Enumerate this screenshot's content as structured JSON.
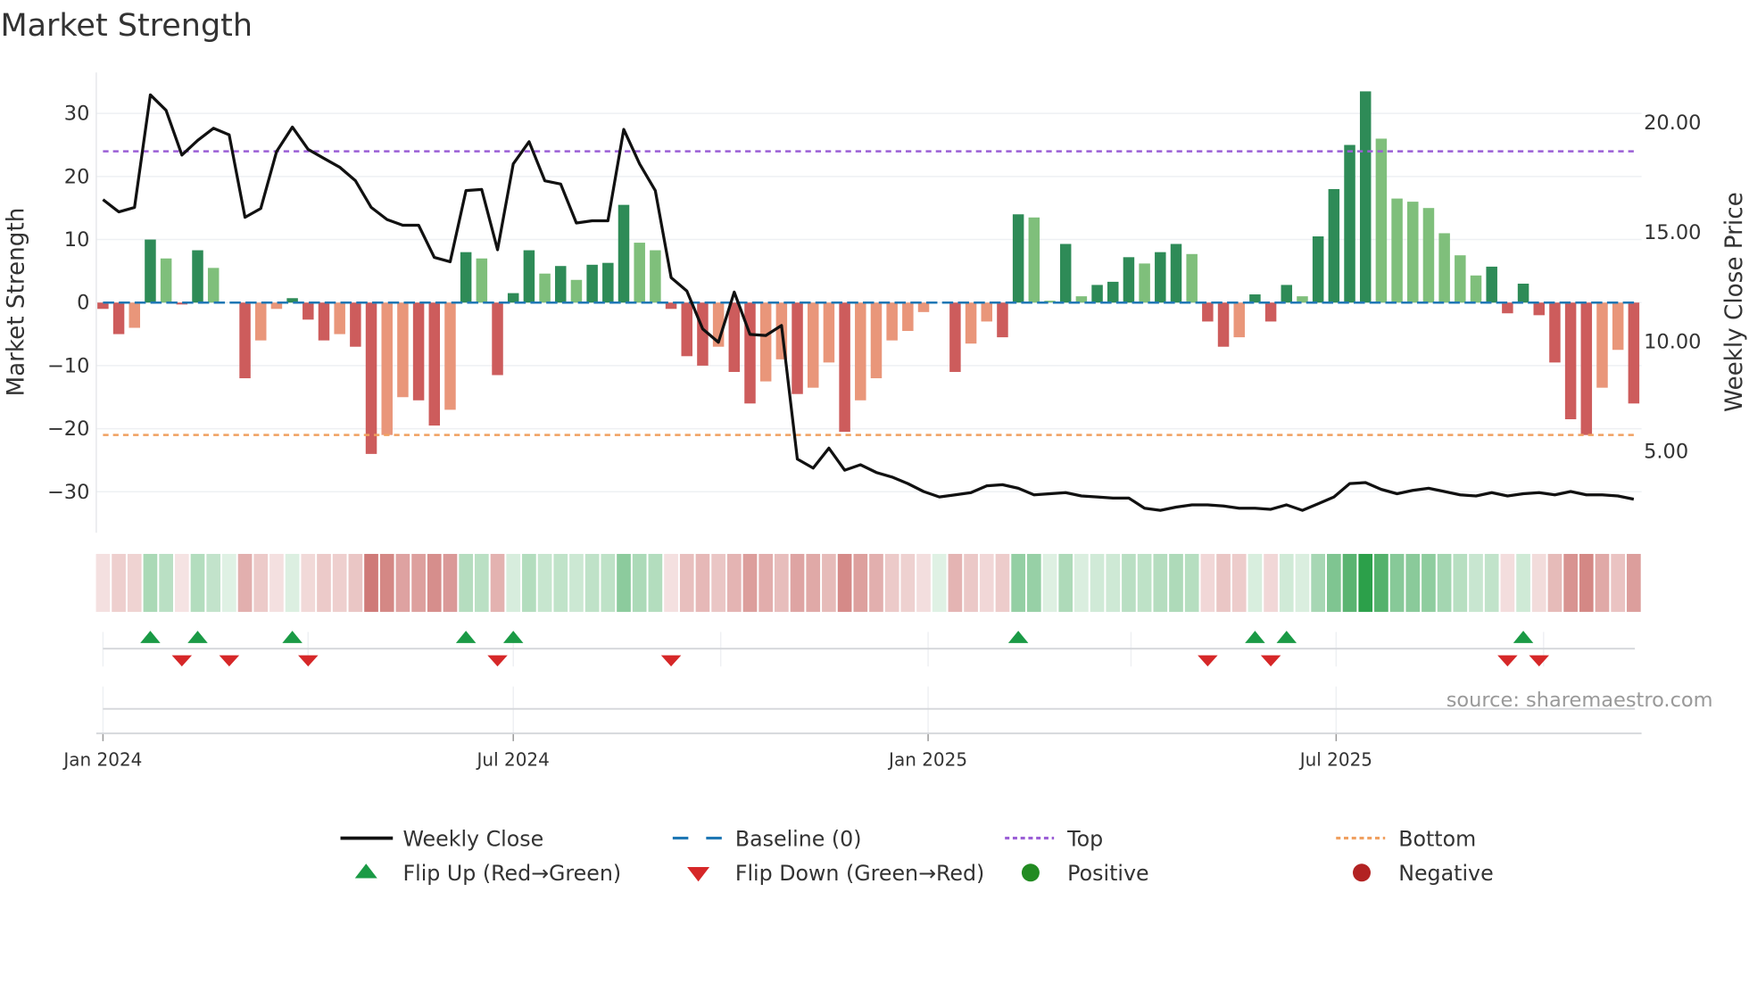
{
  "chart_data": {
    "type": "bar",
    "title": "Market Strength",
    "ylabel": "Market Strength",
    "y2label": "Weekly Close Price",
    "source": "source: sharemaestro.com",
    "start_week": "2024-01-01",
    "interval": "weekly",
    "ylim": [
      -36.5,
      36.5
    ],
    "y2lim": [
      1.24,
      22.24
    ],
    "yticks": [
      30,
      20,
      10,
      0,
      -10,
      -20,
      -30
    ],
    "ytick_labels": [
      "30",
      "20",
      "10",
      "0",
      "−10",
      "−20",
      "−30"
    ],
    "y2ticks": [
      20,
      15,
      10,
      5
    ],
    "y2tick_labels": [
      "20.00",
      "15.00",
      "10.00",
      "5.00"
    ],
    "xticks": [
      {
        "date": "2024-01-01",
        "label": "Jan 2024"
      },
      {
        "date": "2024-07-01",
        "label": "Jul 2024"
      },
      {
        "date": "2025-01-01",
        "label": "Jan 2025"
      },
      {
        "date": "2025-07-01",
        "label": "Jul 2025"
      }
    ],
    "flip_panel_grid_dates": [
      "2024-01-01",
      "2024-04-01",
      "2024-07-01",
      "2024-10-01",
      "2025-01-01",
      "2025-04-01",
      "2025-07-01",
      "2025-10-01"
    ],
    "top_level": 24,
    "bottom_level": -21,
    "baseline": 0,
    "strength": [
      -1,
      -5,
      -4,
      10,
      7,
      -0.3,
      8.3,
      5.5,
      0,
      -12,
      -6,
      -1,
      0.7,
      -2.7,
      -6,
      -5,
      -7,
      -24,
      -21,
      -15,
      -15.5,
      -19.5,
      -17,
      8,
      7,
      -11.5,
      1.5,
      8.3,
      4.6,
      5.8,
      3.6,
      6,
      6.3,
      15.5,
      9.5,
      8.3,
      -1,
      -8.5,
      -10,
      -7,
      -11,
      -16,
      -12.5,
      -9,
      -14.5,
      -13.5,
      -9.5,
      -20.5,
      -15.5,
      -12,
      -6,
      -4.5,
      -1.5,
      0,
      -11,
      -6.5,
      -3,
      -5.5,
      14,
      13.5,
      0.3,
      9.3,
      1,
      2.8,
      3.3,
      7.2,
      6.2,
      8,
      9.3,
      7.7,
      -3,
      -7,
      -5.5,
      1.3,
      -3,
      2.8,
      1,
      10.5,
      18,
      25,
      33.5,
      26,
      16.5,
      16,
      15,
      11,
      7.5,
      4.3,
      5.7,
      -1.7,
      3,
      -2,
      -9.5,
      -18.5,
      -21,
      -13.5,
      -7.5,
      -16
    ],
    "weekly_close": [
      16.44,
      15.88,
      16.08,
      21.22,
      20.51,
      18.47,
      19.14,
      19.69,
      19.39,
      15.63,
      16.03,
      18.63,
      19.75,
      18.73,
      18.32,
      17.92,
      17.3,
      16.08,
      15.53,
      15.27,
      15.27,
      13.8,
      13.6,
      16.85,
      16.9,
      14.15,
      18.07,
      19.08,
      17.3,
      17.15,
      15.37,
      15.47,
      15.47,
      19.64,
      18.07,
      16.85,
      12.88,
      12.27,
      10.54,
      9.93,
      12.22,
      10.29,
      10.24,
      10.7,
      4.6,
      4.19,
      5.1,
      4.09,
      4.34,
      3.99,
      3.78,
      3.48,
      3.12,
      2.87,
      2.97,
      3.07,
      3.38,
      3.43,
      3.27,
      2.97,
      3.02,
      3.07,
      2.92,
      2.87,
      2.82,
      2.82,
      2.36,
      2.26,
      2.41,
      2.51,
      2.51,
      2.46,
      2.36,
      2.36,
      2.31,
      2.51,
      2.26,
      2.56,
      2.87,
      3.48,
      3.53,
      3.22,
      3.02,
      3.17,
      3.27,
      3.12,
      2.97,
      2.92,
      3.07,
      2.92,
      3.02,
      3.07,
      2.97,
      3.12,
      2.97,
      2.97,
      2.92,
      2.77
    ],
    "flip_up_weeks": [
      3,
      6,
      12,
      23,
      26,
      58,
      73,
      75,
      90
    ],
    "flip_down_weeks": [
      5,
      8,
      13,
      25,
      36,
      70,
      74,
      89,
      91
    ],
    "legend": {
      "placement": "bottom-center",
      "items": [
        {
          "label": "Weekly Close",
          "kind": "line"
        },
        {
          "label": "Baseline (0)",
          "kind": "dash"
        },
        {
          "label": "Top",
          "kind": "dot-top"
        },
        {
          "label": "Bottom",
          "kind": "dot-bottom"
        },
        {
          "label": "Flip Up (Red→Green)",
          "kind": "tri-up"
        },
        {
          "label": "Flip Down (Green→Red)",
          "kind": "tri-down"
        },
        {
          "label": "Positive",
          "kind": "circle-pos"
        },
        {
          "label": "Negative",
          "kind": "circle-neg"
        }
      ]
    },
    "colors": {
      "pos_rising": "#2e8b57",
      "pos_falling": "#7fbf7b",
      "neg_falling": "#cd5c5c",
      "neg_rising": "#e9967a",
      "line": "#111111",
      "baseline": "#1f77b4",
      "top": "#9b5fd6",
      "bottom": "#f0a060",
      "flip_up": "#1a9a45",
      "flip_down": "#d62728",
      "positive": "#228b22",
      "negative": "#b22222",
      "heat_pos": [
        44,
        160,
        74
      ],
      "heat_neg": [
        192,
        80,
        77
      ]
    }
  }
}
